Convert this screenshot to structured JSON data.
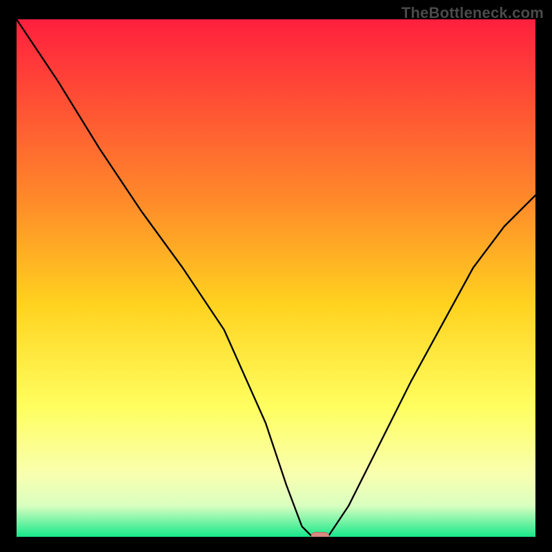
{
  "watermark": "TheBottleneck.com",
  "colors": {
    "black": "#000000",
    "curve": "#000000",
    "marker_fill": "#d68a82",
    "marker_stroke": "#b46a62",
    "grad_top": "#ff1f3e",
    "grad_mid1": "#ff8a2a",
    "grad_mid2": "#ffd21f",
    "grad_mid3": "#ffff60",
    "grad_mid4": "#f9ffb0",
    "grad_mid5": "#d9ffc0",
    "grad_bottom": "#17e88b"
  },
  "chart_data": {
    "type": "line",
    "title": "",
    "xlabel": "",
    "ylabel": "",
    "xlim": [
      0,
      100
    ],
    "ylim": [
      0,
      100
    ],
    "series": [
      {
        "name": "bottleneck-curve",
        "x": [
          0,
          8,
          16,
          24,
          32,
          40,
          48,
          52,
          55,
          57,
          60,
          64,
          68,
          72,
          76,
          82,
          88,
          94,
          100
        ],
        "y": [
          100,
          88,
          75,
          63,
          52,
          40,
          22,
          10,
          2,
          0,
          0,
          6,
          14,
          22,
          30,
          41,
          52,
          60,
          66
        ]
      }
    ],
    "marker": {
      "x": 58.5,
      "y": 0,
      "label": "optimal-point"
    },
    "gradient_stops": [
      {
        "offset": 0.0,
        "color": "#ff1f3e"
      },
      {
        "offset": 0.35,
        "color": "#ff8a2a"
      },
      {
        "offset": 0.55,
        "color": "#ffd21f"
      },
      {
        "offset": 0.75,
        "color": "#ffff60"
      },
      {
        "offset": 0.88,
        "color": "#f9ffb0"
      },
      {
        "offset": 0.94,
        "color": "#d9ffc0"
      },
      {
        "offset": 1.0,
        "color": "#17e88b"
      }
    ]
  }
}
